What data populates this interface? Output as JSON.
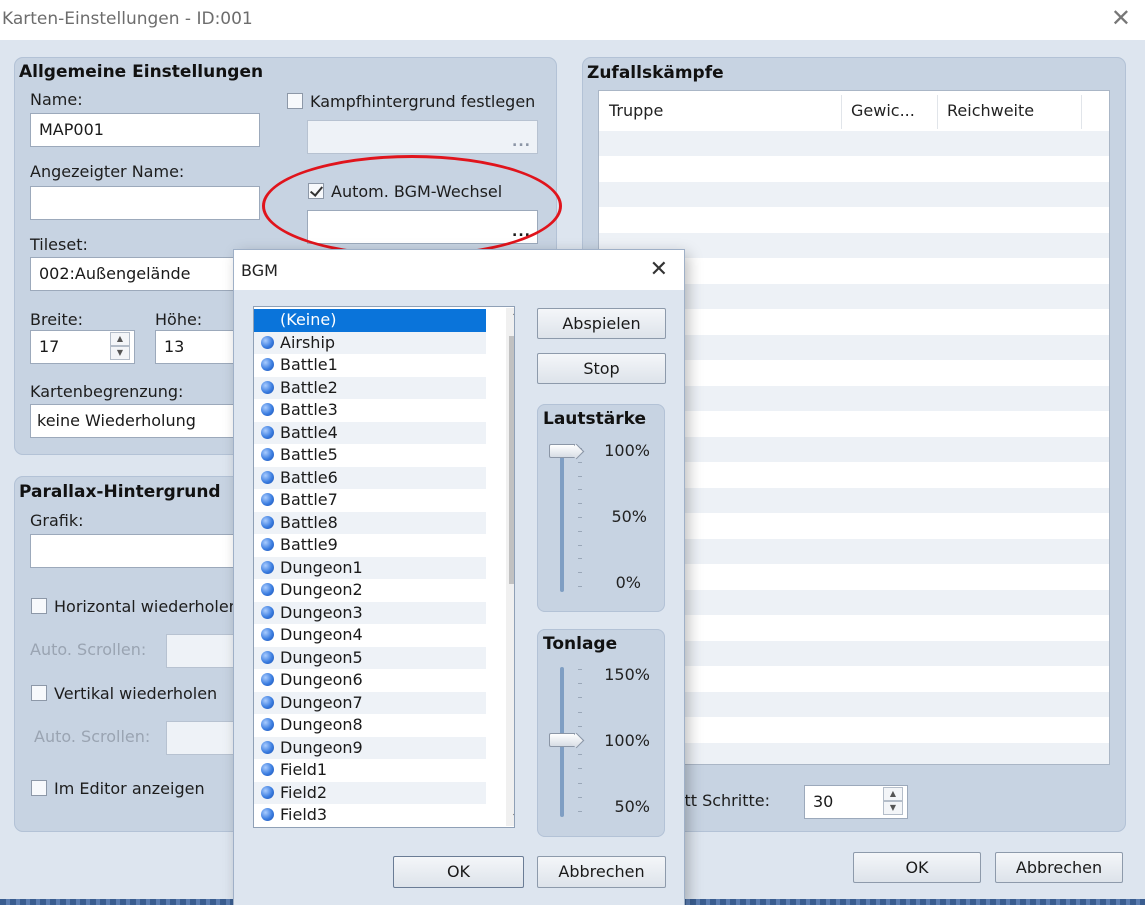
{
  "window": {
    "title": "Karten-Einstellungen - ID:001",
    "close_glyph": "✕"
  },
  "general": {
    "title": "Allgemeine Einstellungen",
    "name_label": "Name:",
    "name_value": "MAP001",
    "display_name_label": "Angezeigter Name:",
    "display_name_value": "",
    "tileset_label": "Tileset:",
    "tileset_value": "002:Außengelände",
    "width_label": "Breite:",
    "width_value": "17",
    "height_label": "Höhe:",
    "height_value": "13",
    "scroll_label": "Kartenbegrenzung:",
    "scroll_value": "keine Wiederholung",
    "battleback_label": "Kampfhintergrund festlegen",
    "battleback_checked": false,
    "autobgm_label": "Autom. BGM-Wechsel",
    "autobgm_checked": true,
    "dots": "..."
  },
  "parallax": {
    "title": "Parallax-Hintergrund",
    "graphic_label": "Grafik:",
    "loop_h_label": "Horizontal wiederholen",
    "auto_scroll_label": "Auto. Scrollen:",
    "loop_v_label": "Vertikal wiederholen",
    "auto_scroll_label_2": "Auto. Scrollen:",
    "show_editor_label": "Im Editor anzeigen"
  },
  "encounters": {
    "title": "Zufallskämpfe",
    "columns": [
      "Truppe",
      "Gewic...",
      "Reichweite"
    ],
    "steps_label": "itt Schritte:",
    "steps_value": "30"
  },
  "main_buttons": {
    "ok": "OK",
    "cancel": "Abbrechen"
  },
  "bgm_dialog": {
    "title": "BGM",
    "close_glyph": "✕",
    "items": [
      "(Keine)",
      "Airship",
      "Battle1",
      "Battle2",
      "Battle3",
      "Battle4",
      "Battle5",
      "Battle6",
      "Battle7",
      "Battle8",
      "Battle9",
      "Dungeon1",
      "Dungeon2",
      "Dungeon3",
      "Dungeon4",
      "Dungeon5",
      "Dungeon6",
      "Dungeon7",
      "Dungeon8",
      "Dungeon9",
      "Field1",
      "Field2",
      "Field3"
    ],
    "selected": "(Keine)",
    "play_label": "Abspielen",
    "stop_label": "Stop",
    "volume": {
      "title": "Lautstärke",
      "labels": [
        "100%",
        "50%",
        "0%"
      ],
      "value_percent": 100
    },
    "pitch": {
      "title": "Tonlage",
      "labels": [
        "150%",
        "100%",
        "50%"
      ],
      "value_percent": 100
    },
    "ok_label": "OK",
    "cancel_label": "Abbrechen",
    "scroll_up_glyph": "⌃",
    "scroll_down_glyph": "⌄"
  },
  "spin_glyphs": {
    "up": "▲",
    "down": "▼"
  },
  "colors": {
    "annotation": "#e0141c",
    "selection": "#0a74da"
  }
}
